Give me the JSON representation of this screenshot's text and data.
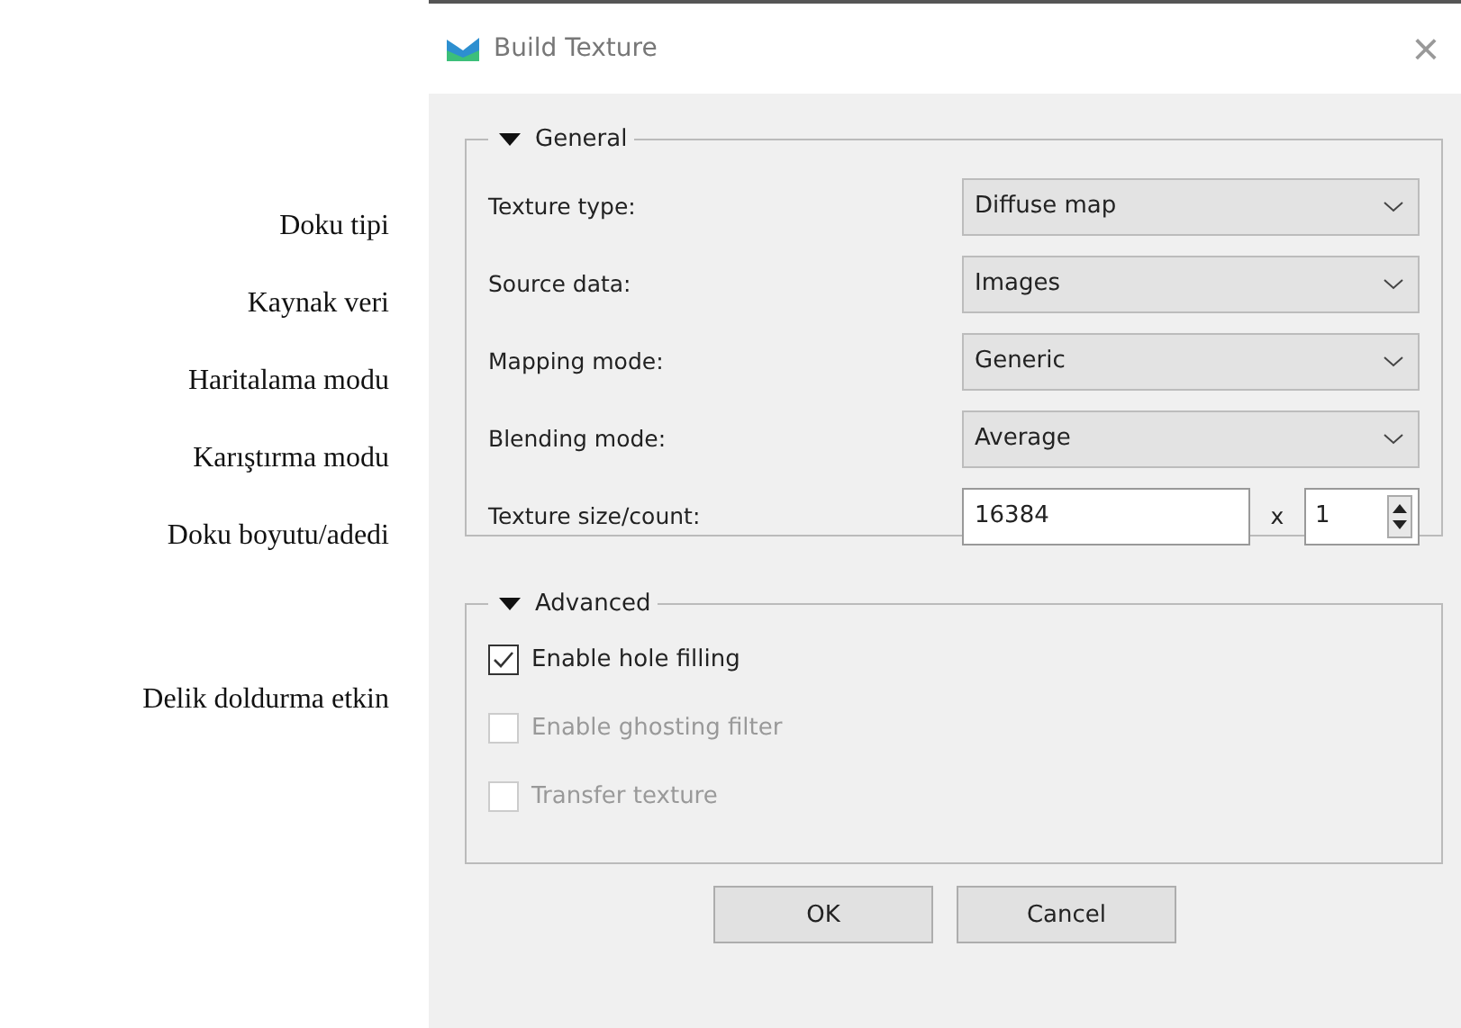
{
  "side_notes": [
    "Doku tipi",
    "Kaynak veri",
    "Haritalama modu",
    "Karıştırma modu",
    "Doku boyutu/adedi",
    "Delik doldurma etkin"
  ],
  "window": {
    "title": "Build Texture",
    "close": "×"
  },
  "general": {
    "title": "General",
    "expanded": true,
    "rows": [
      {
        "kind": "combo",
        "label": "Texture type:",
        "value": "Diffuse map"
      },
      {
        "kind": "combo",
        "label": "Source data:",
        "value": "Images"
      },
      {
        "kind": "combo",
        "label": "Mapping mode:",
        "value": "Generic"
      },
      {
        "kind": "combo",
        "label": "Blending mode:",
        "value": "Average"
      },
      {
        "kind": "size",
        "label": "Texture size/count:",
        "value": "16384",
        "separator": "x",
        "count": "1"
      }
    ]
  },
  "advanced": {
    "title": "Advanced",
    "expanded": true,
    "options": [
      {
        "label": "Enable hole filling",
        "checked": true,
        "disabled": false
      },
      {
        "label": "Enable ghosting filter",
        "checked": false,
        "disabled": true
      },
      {
        "label": "Transfer texture",
        "checked": false,
        "disabled": true
      }
    ]
  },
  "buttons": [
    "OK",
    "Cancel"
  ]
}
